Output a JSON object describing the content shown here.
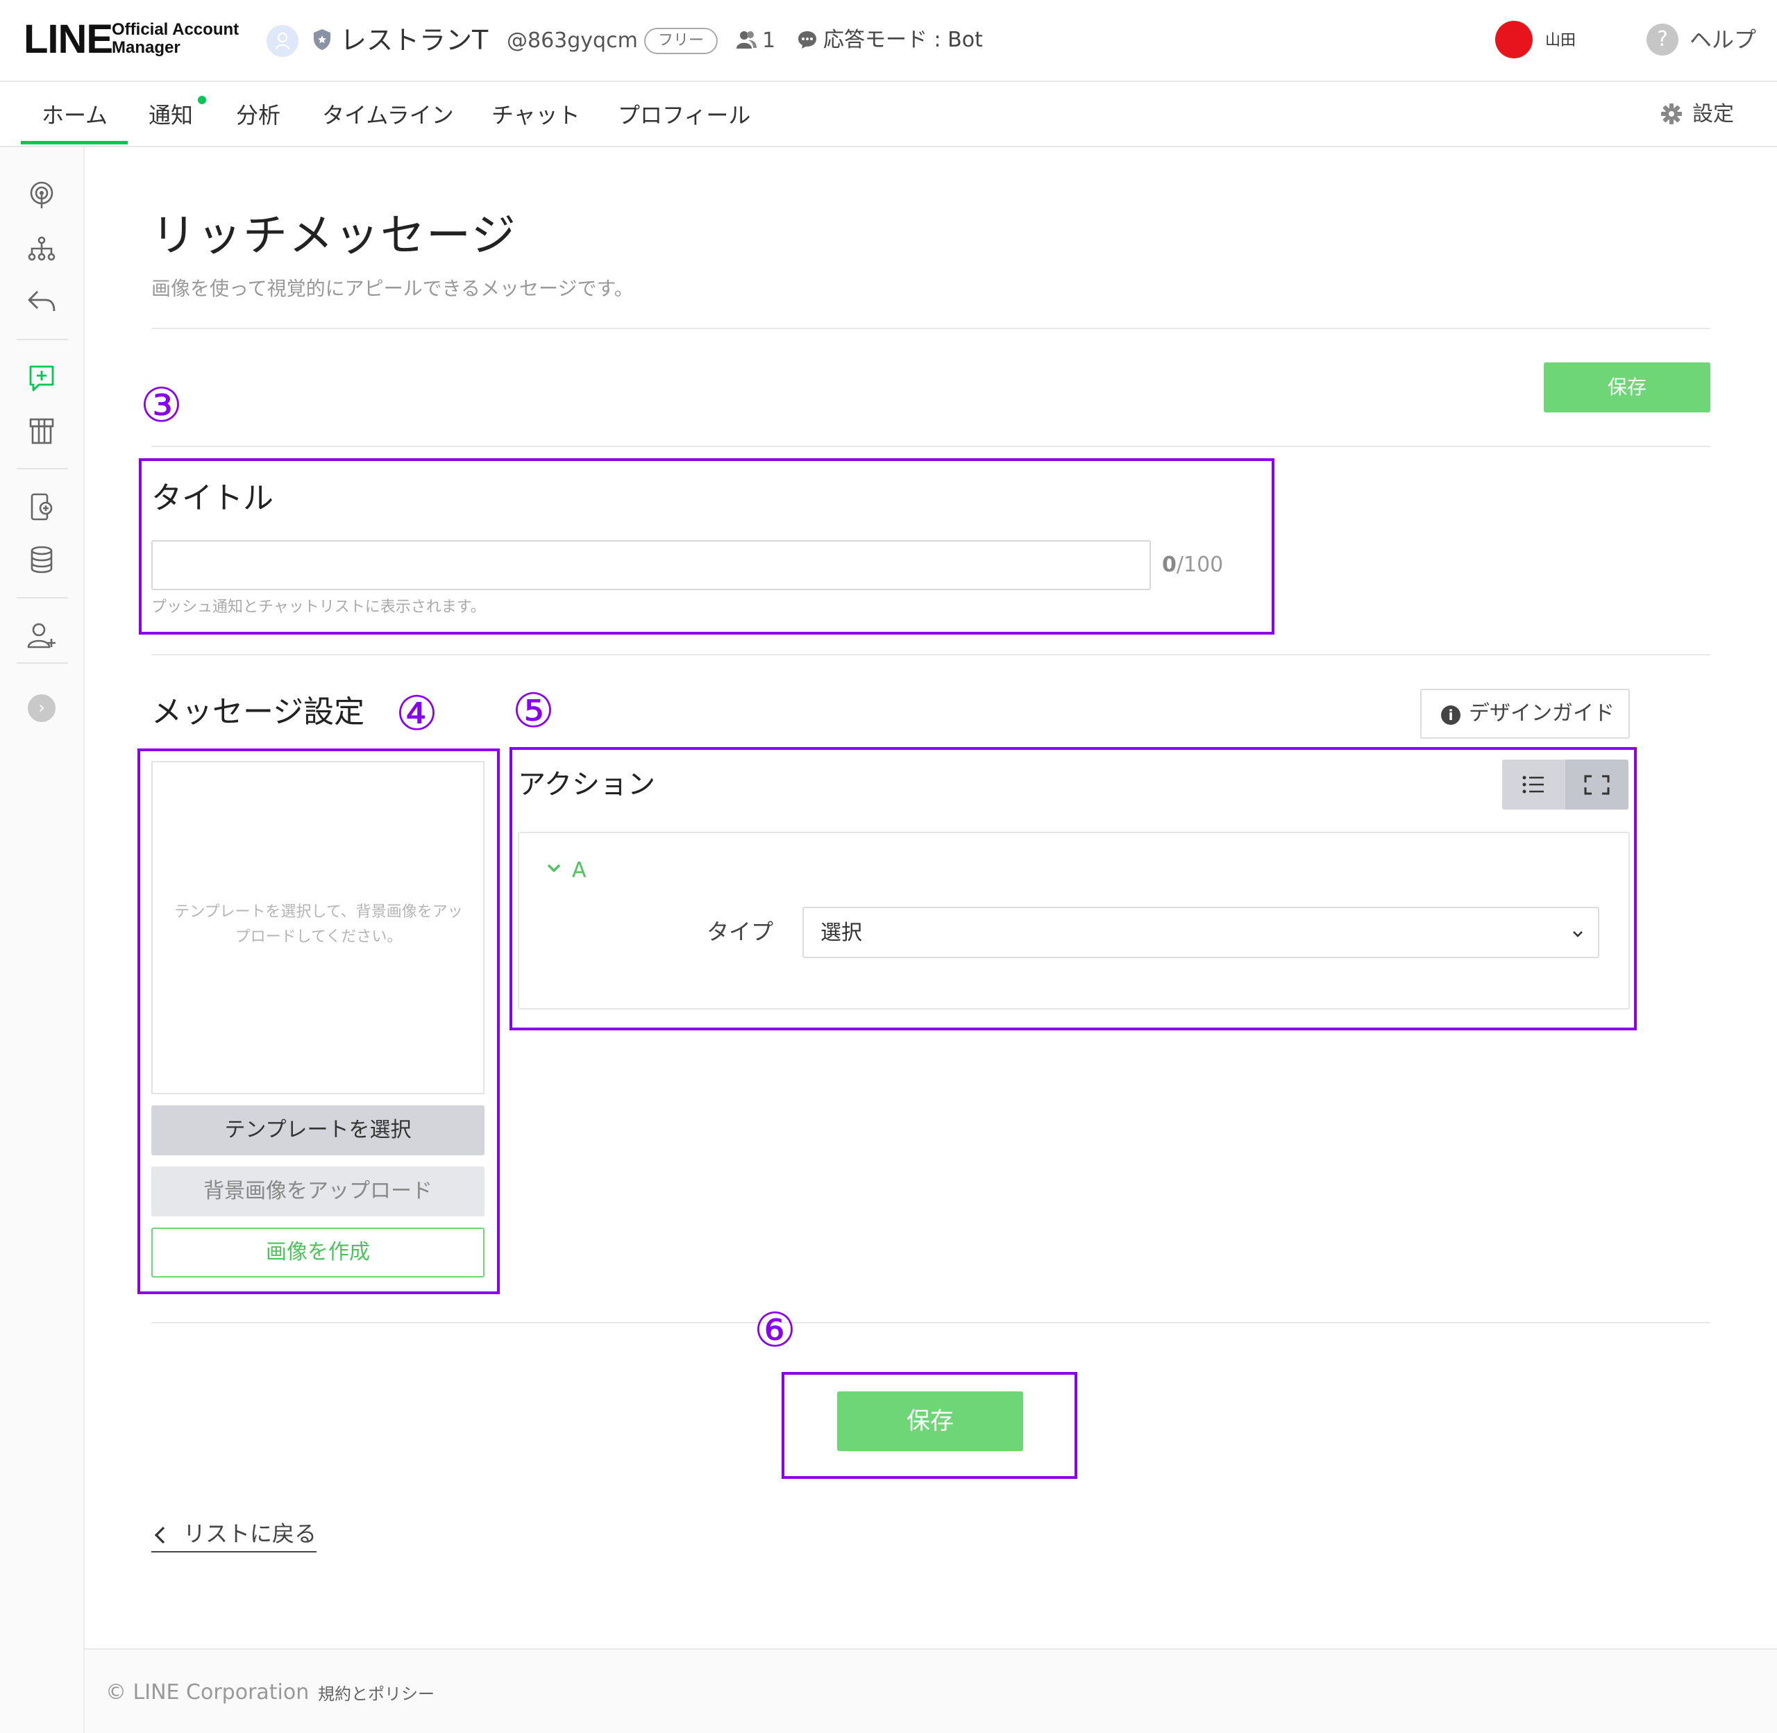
{
  "header": {
    "logo_main": "LINE",
    "logo_sub_1": "Official Account",
    "logo_sub_2": "Manager",
    "account_name": "レストランT",
    "account_id": "@863gyqcm",
    "plan_badge": "フリー",
    "friends_count": "1",
    "response_mode": "応答モード : Bot",
    "user_name": "山田",
    "help_label": "ヘルプ"
  },
  "tabs": [
    {
      "label": "ホーム",
      "active": true
    },
    {
      "label": "通知"
    },
    {
      "label": "分析"
    },
    {
      "label": "タイムライン"
    },
    {
      "label": "チャット"
    },
    {
      "label": "プロフィール"
    }
  ],
  "settings_label": "設定",
  "rail_icons": [
    "broadcast-icon",
    "hierarchy-icon",
    "reply-icon",
    "rich-message-icon",
    "coupon-icon",
    "mobile-card-icon",
    "database-icon",
    "add-user-icon",
    "expand-icon"
  ],
  "page": {
    "title": "リッチメッセージ",
    "subtitle": "画像を使って視覚的にアピールできるメッセージです。",
    "save_top": "保存",
    "save_bottom": "保存",
    "back_link": "リストに戻る"
  },
  "annotations": {
    "n3": "③",
    "n4": "④",
    "n5": "⑤",
    "n6": "⑥"
  },
  "title_section": {
    "label": "タイトル",
    "value": "",
    "counter_current": "0",
    "counter_max": "/100",
    "hint": "プッシュ通知とチャットリストに表示されます。"
  },
  "message_settings": {
    "label": "メッセージ設定",
    "design_guide": "デザインガイド",
    "preview_hint_1": "テンプレートを選択して、背景画像をアッ",
    "preview_hint_2": "プロードしてください。",
    "btn_template": "テンプレートを選択",
    "btn_upload": "背景画像をアップロード",
    "btn_create": "画像を作成"
  },
  "action": {
    "label": "アクション",
    "item_label": "A",
    "type_label": "タイプ",
    "type_value": "選択"
  },
  "footer": {
    "copyright": "© LINE Corporation",
    "terms": "規約とポリシー"
  },
  "colors": {
    "accent": "#06c755",
    "button_green": "#6fd677",
    "annotation": "#8800ee",
    "user_avatar": "#e8141c"
  }
}
